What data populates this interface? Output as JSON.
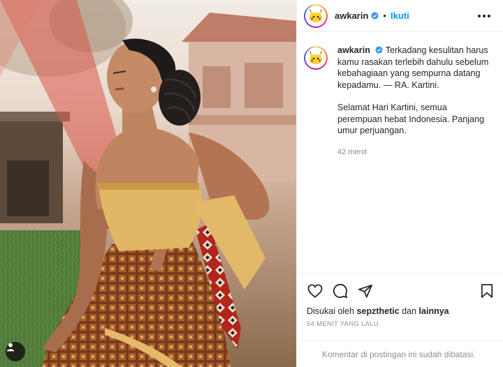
{
  "post": {
    "username": "awkarin",
    "follow_label": "Ikuti",
    "separator": "•"
  },
  "caption": {
    "username": "awkarin",
    "text": "Terkadang kesulitan harus kamu rasakan terlebih dahulu sebelum kebahagiaan yang sempurna datang kepadamu. — RA. Kartini.",
    "text2": "Selamat Hari Kartini, semua perempuan hebat Indonesia. Panjang umur perjuangan.",
    "time": "42 menit"
  },
  "likes": {
    "prefix": "Disukai oleh",
    "user": "sepzthetic",
    "connector": "dan",
    "others": "lainnya"
  },
  "post_time": "54 MENIT YANG LALU",
  "comments_disabled": "Komentar di postingan ini sudah dibatasi.",
  "icons": {
    "verified": "verified-badge-icon",
    "more": "more-options-icon",
    "like": "heart-icon",
    "comment": "comment-icon",
    "share": "share-icon",
    "save": "bookmark-icon",
    "tag": "user-tag-icon"
  },
  "colors": {
    "accent": "#0095f6",
    "text": "#262626",
    "muted": "#8e8e8e",
    "border": "#efefef"
  }
}
